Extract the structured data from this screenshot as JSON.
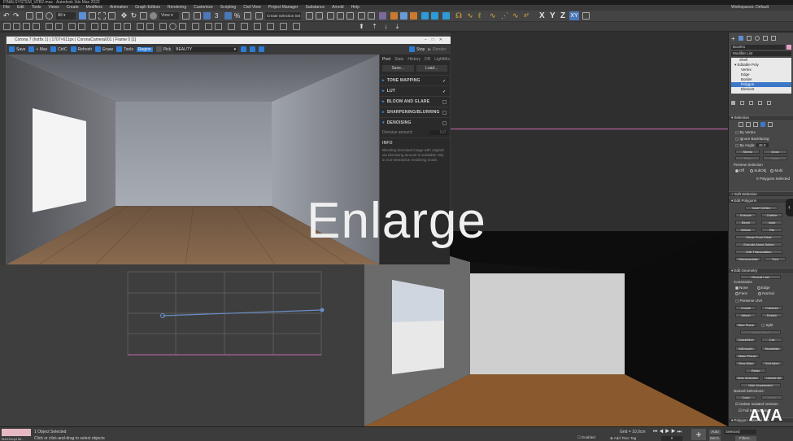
{
  "window": {
    "title": "FINALSYSTEM_VFB2.max - Autodesk 3ds Max 2022",
    "workspace_label": "Workspaces:",
    "workspace_value": "Default"
  },
  "menu": [
    "File",
    "Edit",
    "Tools",
    "Views",
    "Create",
    "Modifiers",
    "Animation",
    "Graph Editors",
    "Rendering",
    "Customize",
    "Scripting",
    "Civil View",
    "Project Manager",
    "Substance",
    "Arnold",
    "Help"
  ],
  "toolbar": {
    "view_dropdown": "View",
    "selection_set": "Create Selection Set",
    "axis_x": "X",
    "axis_y": "Y",
    "axis_z": "Z",
    "axis_xy": "XY"
  },
  "vfb": {
    "title": "Corona 7 (hotfix 1) | 1707×611px | CoronaCamera001 | Frame 0 [1]",
    "tools": [
      "Save",
      "+ Max",
      "CtrlC",
      "Refresh",
      "Erase",
      "Tools",
      "Region",
      "Pick"
    ],
    "pass": "BEAUTY",
    "stop": "Stop",
    "render": "Render",
    "tabs": [
      "Post",
      "Stats",
      "History",
      "DR",
      "LightMix"
    ],
    "btn_save": "Save...",
    "btn_load": "Load...",
    "sections": [
      "TONE MAPPING",
      "LUT",
      "BLOOM AND GLARE",
      "SHARPENING/BLURRING",
      "DENOISING"
    ],
    "denoise_label": "Denoise amount:",
    "denoise_value": "0.0",
    "info_head": "INFO",
    "info_text": "Blending denoised image with original via denoising amount is available only in non-interactive rendering mode."
  },
  "command_panel": {
    "object_name": "Box001",
    "modifier_list": "Modifier List",
    "stack": [
      "Shell",
      "Editable Poly",
      "Vertex",
      "Edge",
      "Border",
      "Polygon",
      "Element"
    ],
    "sections": {
      "selection": "Selection",
      "soft_selection": "Soft Selection",
      "edit_polygons": "Edit Polygons",
      "edit_geometry": "Edit Geometry",
      "polygon_material": "Polygon: Material IDs"
    },
    "selection_opts": [
      "By Vertex",
      "Ignore Backfacing",
      "By Angle:"
    ],
    "angle_value": "45.0",
    "shrink": "Shrink",
    "grow": "Grow",
    "ring": "Ring",
    "loop": "Loop",
    "preview": "Preview Selection",
    "preview_opts": [
      "Off",
      "SubObj",
      "Multi"
    ],
    "selected_info": "0 Polygons Selected",
    "ep_buttons": [
      "Insert Vertex",
      "Extrude",
      "Outline",
      "Bevel",
      "Inset",
      "Bridge",
      "Flip",
      "Hinge From Edge",
      "Extrude Along Spline",
      "Edit Triangulation",
      "Retriangulate",
      "Turn"
    ],
    "eg_buttons": [
      "Repeat Last",
      "Create",
      "Collapse",
      "Attach",
      "Detach",
      "Slice Plane",
      "Split",
      "Reset Plane",
      "QuickSlice",
      "Cut",
      "MSmooth",
      "Tessellate",
      "Make Planar",
      "View Align",
      "Grid Align",
      "Relax",
      "Hide Selected",
      "Unhide All",
      "Hide Unselected",
      "Copy",
      "Paste"
    ],
    "constraints": "Constraints",
    "constraint_opts": [
      "None",
      "Edge",
      "Face",
      "Normal"
    ],
    "preserve_uvs": "Preserve UVs",
    "named_selections": "Named Selections:",
    "delete_isolated": "Delete Isolated Vertices",
    "full_interactivity": "Full Interactivity"
  },
  "status": {
    "objects": "1 Object Selected",
    "hint": "Click or click-and-drag to select objects",
    "script_label": "MAXScript Mi...",
    "grid": "Grid = 10,0cm",
    "add_time_tag": "Add Time Tag",
    "auto": "Auto",
    "selected": "Selected",
    "set_k": "Set K.",
    "filters": "Filters...",
    "frame": "0",
    "enabled": "Enabled"
  },
  "overlay": {
    "caption": "Enlarge",
    "logo": "AVA"
  }
}
